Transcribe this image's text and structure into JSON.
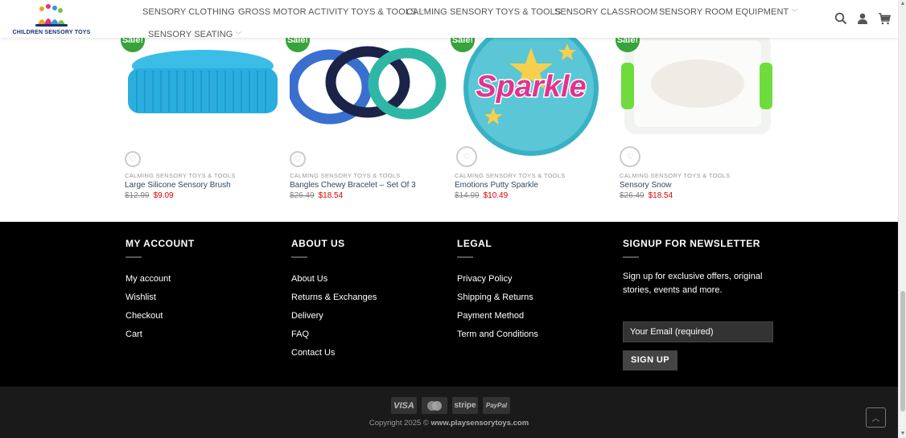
{
  "header": {
    "logo_text": "CHILDREN SENSORY TOYS",
    "nav": [
      {
        "label": "SENSORY CLOTHING"
      },
      {
        "label": "GROSS MOTOR ACTIVITY TOYS & TOOLS"
      },
      {
        "label": "CALMING SENSORY TOYS & TOOLS"
      },
      {
        "label": "SENSORY CLASSROOM"
      },
      {
        "label": "SENSORY ROOM EQUIPMENT"
      },
      {
        "label": "SENSORY SEATING"
      }
    ],
    "icons": [
      "search-icon",
      "user-icon",
      "cart-icon"
    ]
  },
  "products": [
    {
      "sale": "Sale!",
      "category": "CALMING SENSORY TOYS & TOOLS",
      "name": "Large Silicone Sensory Brush",
      "old_price": "$12.99",
      "price": "$9.09"
    },
    {
      "sale": "Sale!",
      "category": "CALMING SENSORY TOYS & TOOLS",
      "name": "Bangles Chewy Bracelet – Set Of 3",
      "old_price": "$26.49",
      "price": "$18.54"
    },
    {
      "sale": "Sale!",
      "category": "CALMING SENSORY TOYS & TOOLS",
      "name": "Emotions Putty Sparkle",
      "old_price": "$14.99",
      "price": "$10.49",
      "image_text": "Sparkle"
    },
    {
      "sale": "Sale!",
      "category": "CALMING SENSORY TOYS & TOOLS",
      "name": "Sensory Snow",
      "old_price": "$26.49",
      "price": "$18.54"
    }
  ],
  "footer": {
    "my_account": {
      "title": "MY ACCOUNT",
      "links": [
        "My account",
        "Wishlist",
        "Checkout",
        "Cart"
      ]
    },
    "about_us": {
      "title": "ABOUT US",
      "links": [
        "About Us",
        "Returns & Exchanges",
        "Delivery",
        "FAQ",
        "Contact Us"
      ]
    },
    "legal": {
      "title": "LEGAL",
      "links": [
        "Privacy Policy",
        "Shipping & Returns",
        "Payment Method",
        "Term and Conditions"
      ]
    },
    "newsletter": {
      "title": "SIGNUP FOR NEWSLETTER",
      "text": "Sign up for exclusive offers, original stories, events and more.",
      "placeholder": "Your Email (required)",
      "button": "SIGN UP"
    }
  },
  "bottom": {
    "payment_icons": [
      "VISA",
      "MC",
      "stripe",
      "PayPal"
    ],
    "copyright_prefix": "Copyright 2025 ©",
    "copyright_site": "www.playsensorytoys.com"
  },
  "colors": {
    "sale": "#37a33a",
    "price": "#dd0000",
    "link": "#334862",
    "footer_bg": "#000000"
  }
}
